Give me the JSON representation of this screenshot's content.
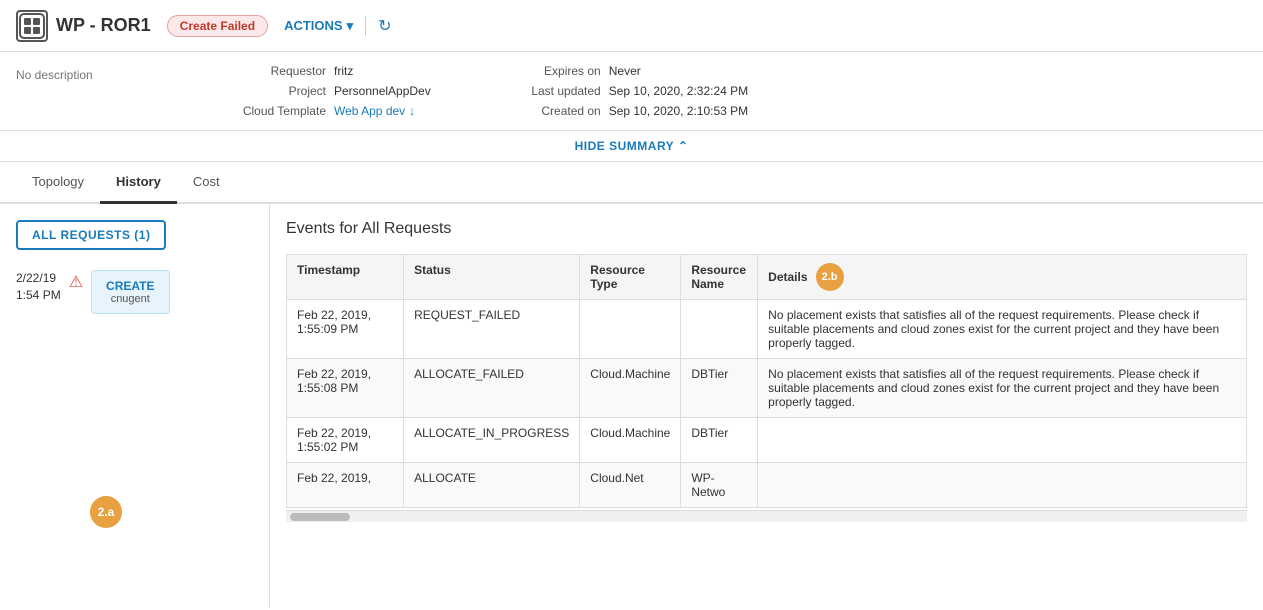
{
  "header": {
    "logo_text": "WP - ROR1",
    "logo_icon": "WP",
    "status_badge": "Create Failed",
    "actions_label": "ACTIONS",
    "refresh_icon": "↻"
  },
  "summary": {
    "no_description": "No description",
    "fields_left": {
      "requestor_label": "Requestor",
      "requestor_value": "fritz",
      "project_label": "Project",
      "project_value": "PersonnelAppDev",
      "cloud_template_label": "Cloud Template",
      "cloud_template_value": "Web App dev",
      "cloud_template_icon": "↓"
    },
    "fields_right": {
      "expires_label": "Expires on",
      "expires_value": "Never",
      "last_updated_label": "Last updated",
      "last_updated_value": "Sep 10, 2020, 2:32:24 PM",
      "created_label": "Created on",
      "created_value": "Sep 10, 2020, 2:10:53 PM"
    },
    "hide_summary": "HIDE SUMMARY"
  },
  "tabs": [
    {
      "label": "Topology",
      "active": false
    },
    {
      "label": "History",
      "active": true
    },
    {
      "label": "Cost",
      "active": false
    }
  ],
  "left_panel": {
    "all_requests_btn": "ALL REQUESTS (1)",
    "request_date": "2/22/19",
    "request_time": "1:54 PM",
    "request_action": "CREATE",
    "request_user": "cnugent",
    "badge_2a": "2.a"
  },
  "right_panel": {
    "title": "Events for All Requests",
    "badge_2b": "2.b",
    "table": {
      "headers": [
        "Timestamp",
        "Status",
        "Resource\nType",
        "Resource\nName",
        "Details"
      ],
      "rows": [
        {
          "timestamp": "Feb 22, 2019, 1:55:09 PM",
          "status": "REQUEST_FAILED",
          "resource_type": "",
          "resource_name": "",
          "details": "No placement exists that satisfies all of the request requirements. Please check if suitable placements and cloud zones exist for the current project and they have been properly tagged."
        },
        {
          "timestamp": "Feb 22, 2019, 1:55:08 PM",
          "status": "ALLOCATE_FAILED",
          "resource_type": "Cloud.Machine",
          "resource_name": "DBTier",
          "details": "No placement exists that satisfies all of the request requirements. Please check if suitable placements and cloud zones exist for the current project and they have been properly tagged."
        },
        {
          "timestamp": "Feb 22, 2019, 1:55:02 PM",
          "status": "ALLOCATE_IN_PROGRESS",
          "resource_type": "Cloud.Machine",
          "resource_name": "DBTier",
          "details": ""
        },
        {
          "timestamp": "Feb 22, 2019,",
          "status": "ALLOCATE",
          "resource_type": "Cloud.Net",
          "resource_name": "WP-Netwo",
          "details": ""
        }
      ]
    }
  }
}
